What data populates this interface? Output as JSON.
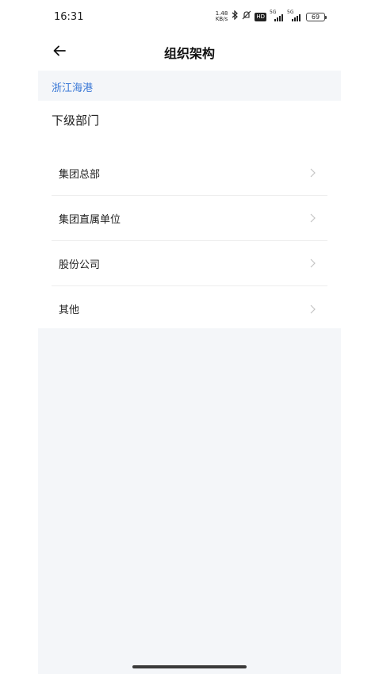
{
  "status_bar": {
    "time": "16:31",
    "net_speed_value": "1.48",
    "net_speed_unit": "KB/s",
    "sim1_label": "5G",
    "sim2_label": "5G",
    "hd_label": "HD",
    "battery": "69",
    "icons": [
      "bluetooth-icon",
      "mute-icon",
      "signal-icon",
      "signal-icon",
      "battery-icon"
    ]
  },
  "header": {
    "title": "组织架构",
    "back_icon": "arrow-left-icon"
  },
  "breadcrumb": {
    "current": "浙江海港"
  },
  "section": {
    "title": "下级部门"
  },
  "departments": [
    {
      "label": "集团总部"
    },
    {
      "label": "集团直属单位"
    },
    {
      "label": "股份公司"
    },
    {
      "label": "其他"
    }
  ],
  "colors": {
    "accent": "#3a78d6",
    "panel_bg": "#f4f6f9",
    "card_bg": "#ffffff",
    "divider": "#eeeeee"
  }
}
